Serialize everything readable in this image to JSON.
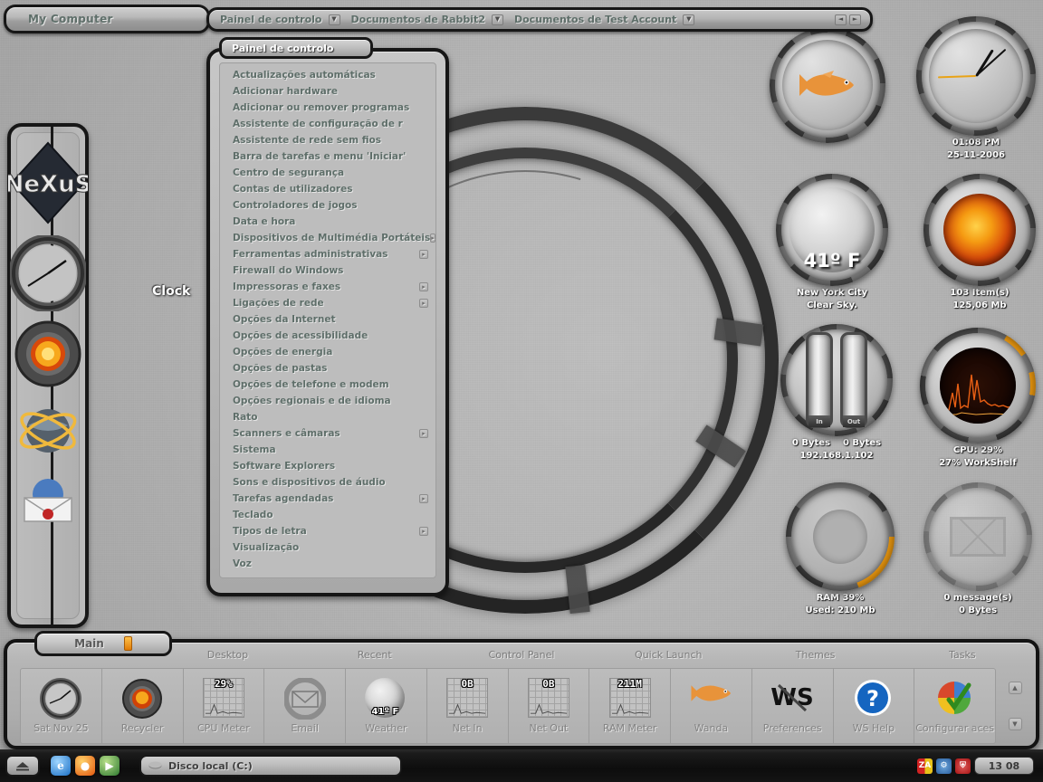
{
  "window_tabs": {
    "primary": "My Computer",
    "items": [
      {
        "label": "Painel de controlo",
        "has_menu": true
      },
      {
        "label": "Documentos de Rabbit2",
        "has_menu": true
      },
      {
        "label": "Documentos de Test Account",
        "has_menu": true
      }
    ],
    "nav_prev": "◄",
    "nav_next": "►"
  },
  "control_panel": {
    "title": "Painel de controlo",
    "items": [
      {
        "label": "Actualizações automáticas",
        "submenu": false
      },
      {
        "label": "Adicionar hardware",
        "submenu": false
      },
      {
        "label": "Adicionar ou remover programas",
        "submenu": false
      },
      {
        "label": "Assistente de configuração de r",
        "submenu": false
      },
      {
        "label": "Assistente de rede sem fios",
        "submenu": false
      },
      {
        "label": "Barra de tarefas e menu 'Iniciar'",
        "submenu": false
      },
      {
        "label": "Centro de segurança",
        "submenu": false
      },
      {
        "label": "Contas de utilizadores",
        "submenu": false
      },
      {
        "label": "Controladores de jogos",
        "submenu": false
      },
      {
        "label": "Data e hora",
        "submenu": false
      },
      {
        "label": "Dispositivos de Multimédia Portáteis",
        "submenu": true
      },
      {
        "label": "Ferramentas administrativas",
        "submenu": true
      },
      {
        "label": "Firewall do Windows",
        "submenu": false
      },
      {
        "label": "Impressoras e faxes",
        "submenu": true
      },
      {
        "label": "Ligações de rede",
        "submenu": true
      },
      {
        "label": "Opções da Internet",
        "submenu": false
      },
      {
        "label": "Opções de acessibilidade",
        "submenu": false
      },
      {
        "label": "Opções de energia",
        "submenu": false
      },
      {
        "label": "Opções de pastas",
        "submenu": false
      },
      {
        "label": "Opções de telefone e modem",
        "submenu": false
      },
      {
        "label": "Opções regionais e de idioma",
        "submenu": false
      },
      {
        "label": "Rato",
        "submenu": false
      },
      {
        "label": "Scanners e câmaras",
        "submenu": true
      },
      {
        "label": "Sistema",
        "submenu": false
      },
      {
        "label": "Software Explorers",
        "submenu": false
      },
      {
        "label": "Sons e dispositivos de áudio",
        "submenu": false
      },
      {
        "label": "Tarefas agendadas",
        "submenu": true
      },
      {
        "label": "Teclado",
        "submenu": false
      },
      {
        "label": "Tipos de letra",
        "submenu": true
      },
      {
        "label": "Visualização",
        "submenu": false
      },
      {
        "label": "Voz",
        "submenu": false
      }
    ],
    "submenu_glyph": "▸"
  },
  "nexus_dock": {
    "logo_text": "NeXuS",
    "tooltip": "Clock",
    "icons": [
      "nexus-logo-icon",
      "clock-icon",
      "cpu-meter-icon",
      "network-globe-icon",
      "email-icon"
    ]
  },
  "gadgets": {
    "fish": {
      "icon": "fish-icon",
      "caption": ""
    },
    "clock": {
      "time": "01:08 PM",
      "date": "25-11-2006"
    },
    "weather": {
      "temperature": "41º F",
      "city": "New York City",
      "condition": "Clear Sky."
    },
    "recycler": {
      "items": "103 Item(s)",
      "size": "125,06 Mb"
    },
    "network": {
      "in_label": "In",
      "out_label": "Out",
      "in_value": "0 Bytes",
      "out_value": "0 Bytes",
      "ip": "192.168.1.102"
    },
    "cpu": {
      "line1": "CPU: 29%",
      "line2": "27% WorkShelf"
    },
    "ram": {
      "line1": "RAM 39%",
      "line2": "Used: 210 Mb"
    },
    "mail": {
      "line1": "0 message(s)",
      "line2": "0 Bytes"
    }
  },
  "dock": {
    "tabs": [
      "Main",
      "Desktop",
      "Recent",
      "Control Panel",
      "Quick Launch",
      "Themes",
      "Tasks"
    ],
    "active_tab": "Main",
    "items": [
      {
        "label": "Sat Nov 25",
        "icon": "clock-icon",
        "value": ""
      },
      {
        "label": "Recycler",
        "icon": "recycler-lava-icon",
        "value": ""
      },
      {
        "label": "CPU Meter",
        "icon": "graph-meter-icon",
        "value": "29%"
      },
      {
        "label": "Email",
        "icon": "email-icon",
        "value": ""
      },
      {
        "label": "Weather",
        "icon": "moon-icon",
        "value": "41º F"
      },
      {
        "label": "Net In",
        "icon": "graph-meter-icon",
        "value": "0B"
      },
      {
        "label": "Net Out",
        "icon": "graph-meter-icon",
        "value": "0B"
      },
      {
        "label": "RAM Meter",
        "icon": "graph-meter-icon",
        "value": "211M"
      },
      {
        "label": "Wanda",
        "icon": "fish-icon",
        "value": ""
      },
      {
        "label": "Preferences",
        "icon": "ws-wand-icon",
        "value": ""
      },
      {
        "label": "WS Help",
        "icon": "question-mark-icon",
        "value": ""
      },
      {
        "label": "Configurar aces",
        "icon": "windows-check-icon",
        "value": ""
      }
    ],
    "scroll_up": "▲",
    "scroll_down": "▼"
  },
  "taskbar": {
    "start_icon": "eject-start-icon",
    "quick_launch": [
      {
        "name": "internet-explorer-icon",
        "glyph": "e"
      },
      {
        "name": "firefox-icon",
        "glyph": "●"
      },
      {
        "name": "media-player-icon",
        "glyph": "▶"
      }
    ],
    "window_button": {
      "label": "Disco local (C:)",
      "icon": "drive-icon"
    },
    "tray_icons": [
      {
        "name": "zonealarm-icon",
        "glyph": "ZA"
      },
      {
        "name": "network-tray-icon",
        "glyph": "⚙"
      },
      {
        "name": "security-shield-icon",
        "glyph": "⛨"
      }
    ],
    "clock": "13 08"
  },
  "colors": {
    "accent_orange": "#e8960f",
    "desktop_gray": "#b2b2b2",
    "text_teal": "#5e6e69"
  }
}
